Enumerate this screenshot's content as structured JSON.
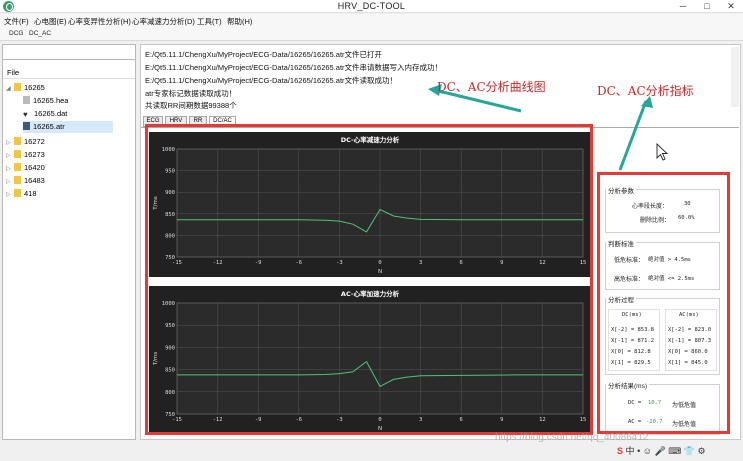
{
  "window": {
    "title": "HRV_DC-TOOL",
    "controls": [
      "─",
      "□",
      "✕"
    ]
  },
  "menubar": {
    "items": [
      "文件(F)",
      "心电图(E)",
      "心率变异性分析(H)",
      "心率减速力分析(D)",
      "工具(T)",
      "帮助(H)"
    ]
  },
  "toolbar": {
    "items": [
      "DCG",
      "DC_AC"
    ]
  },
  "sidebar": {
    "header": "File",
    "tree": [
      {
        "label": "16265",
        "level": 0,
        "expanded": true
      },
      {
        "label": "16265.hea",
        "level": 1,
        "icon": "document-icon"
      },
      {
        "label": "16265.dat",
        "level": 1,
        "icon": "heart-icon"
      },
      {
        "label": "16265.atr",
        "level": 1,
        "icon": "annotation-icon",
        "selected": true
      },
      {
        "label": "16272",
        "level": 0
      },
      {
        "label": "16273",
        "level": 0
      },
      {
        "label": "16420",
        "level": 0
      },
      {
        "label": "16483",
        "level": 0
      },
      {
        "label": "418",
        "level": 0
      }
    ]
  },
  "log": {
    "lines": [
      "E:/Qt5.11.1/ChengXu/MyProject/ECG-Data/16265/16265.atr文件已打开",
      "E:/Qt5.11.1/ChengXu/MyProject/ECG-Data/16265/16265.atr文件串请数据写入内存成功！",
      "E:/Qt5.11.1/ChengXu/MyProject/ECG-Data/16265/16265.atr文件读取成功！",
      "atr专家标记数据读取成功！",
      "共读取RR间期数据99388个"
    ]
  },
  "tabs": [
    "ECG",
    "HRV",
    "RR",
    "DC/AC"
  ],
  "active_tab": "DC/AC",
  "charts": {
    "dc": {
      "title": "DC-心率减速力分析",
      "ylabel": "T/ms",
      "xlabel": "N"
    },
    "ac": {
      "title": "AC-心率加速力分析",
      "ylabel": "T/ms",
      "xlabel": "N"
    }
  },
  "chart_data": [
    {
      "type": "line",
      "title": "DC-心率减速力分析",
      "xlabel": "N",
      "ylabel": "T/ms",
      "xlim": [
        -15,
        15
      ],
      "ylim": [
        750,
        1000
      ],
      "xticks": [
        -15,
        -12,
        -9,
        -6,
        -3,
        0,
        3,
        6,
        9,
        12,
        15
      ],
      "yticks": [
        750,
        800,
        850,
        900,
        950,
        1000
      ],
      "grid": true,
      "series": [
        {
          "color": "#4fc37a",
          "x": [
            -15,
            -10,
            -6,
            -4,
            -3,
            -2,
            -1,
            0,
            1,
            2,
            3,
            6,
            10,
            15
          ],
          "y": [
            836,
            836,
            836,
            835,
            833,
            826,
            808,
            860,
            845,
            840,
            837,
            836,
            836,
            836
          ]
        }
      ]
    },
    {
      "type": "line",
      "title": "AC-心率加速力分析",
      "xlabel": "N",
      "ylabel": "T/ms",
      "xlim": [
        -15,
        15
      ],
      "ylim": [
        750,
        1000
      ],
      "xticks": [
        -15,
        -12,
        -9,
        -6,
        -3,
        0,
        3,
        6,
        9,
        12,
        15
      ],
      "yticks": [
        750,
        800,
        850,
        900,
        950,
        1000
      ],
      "grid": true,
      "series": [
        {
          "color": "#4fc37a",
          "x": [
            -15,
            -10,
            -6,
            -4,
            -3,
            -2,
            -1,
            0,
            1,
            2,
            3,
            6,
            10,
            15
          ],
          "y": [
            838,
            838,
            838,
            839,
            841,
            845,
            868,
            812,
            828,
            833,
            836,
            837,
            838,
            838
          ]
        }
      ]
    }
  ],
  "params": {
    "title": "分析参数",
    "seg_label": "心率段长度：",
    "seg_value": "30",
    "thr_label": "删除比例：",
    "thr_value": "60.0%",
    "criteria_title": "判断标准",
    "low_label": "低危标准：",
    "low_value": "绝对值 > 4.5ms",
    "high_label": "高危标准：",
    "high_value": "绝对值 <= 2.5ms",
    "process_title": "分析过程",
    "dc_col": "DC(ms)",
    "ac_col": "AC(ms)",
    "dc_rows": [
      "X[-2] = 853.8",
      "X[-1] = 871.2",
      "X[0]  = 812.8",
      "X[1]  = 829.5"
    ],
    "ac_rows": [
      "X[-2] = 823.0",
      "X[-1] = 807.3",
      "X[0]  = 860.0",
      "X[1]  = 845.0"
    ],
    "result_title": "分析结果(ms)",
    "dc_label": "DC =",
    "dc_value": "10.7",
    "dc_text": "为低危值",
    "ac_label": "AC =",
    "ac_value": "-20.7",
    "ac_text": "为低危值",
    "value_color": "#2e9c3a"
  },
  "annotations": {
    "left": "DC、AC分析曲线图",
    "right": "DC、AC分析指标",
    "color": "#c62828",
    "arrow_color": "#26a69a"
  },
  "watermark": "https://blog.csdn.net/qq_40086412",
  "ime": {
    "items": [
      "S",
      "中",
      "•",
      "☺",
      "🎤",
      "⌨",
      "👕",
      "⚙"
    ]
  }
}
